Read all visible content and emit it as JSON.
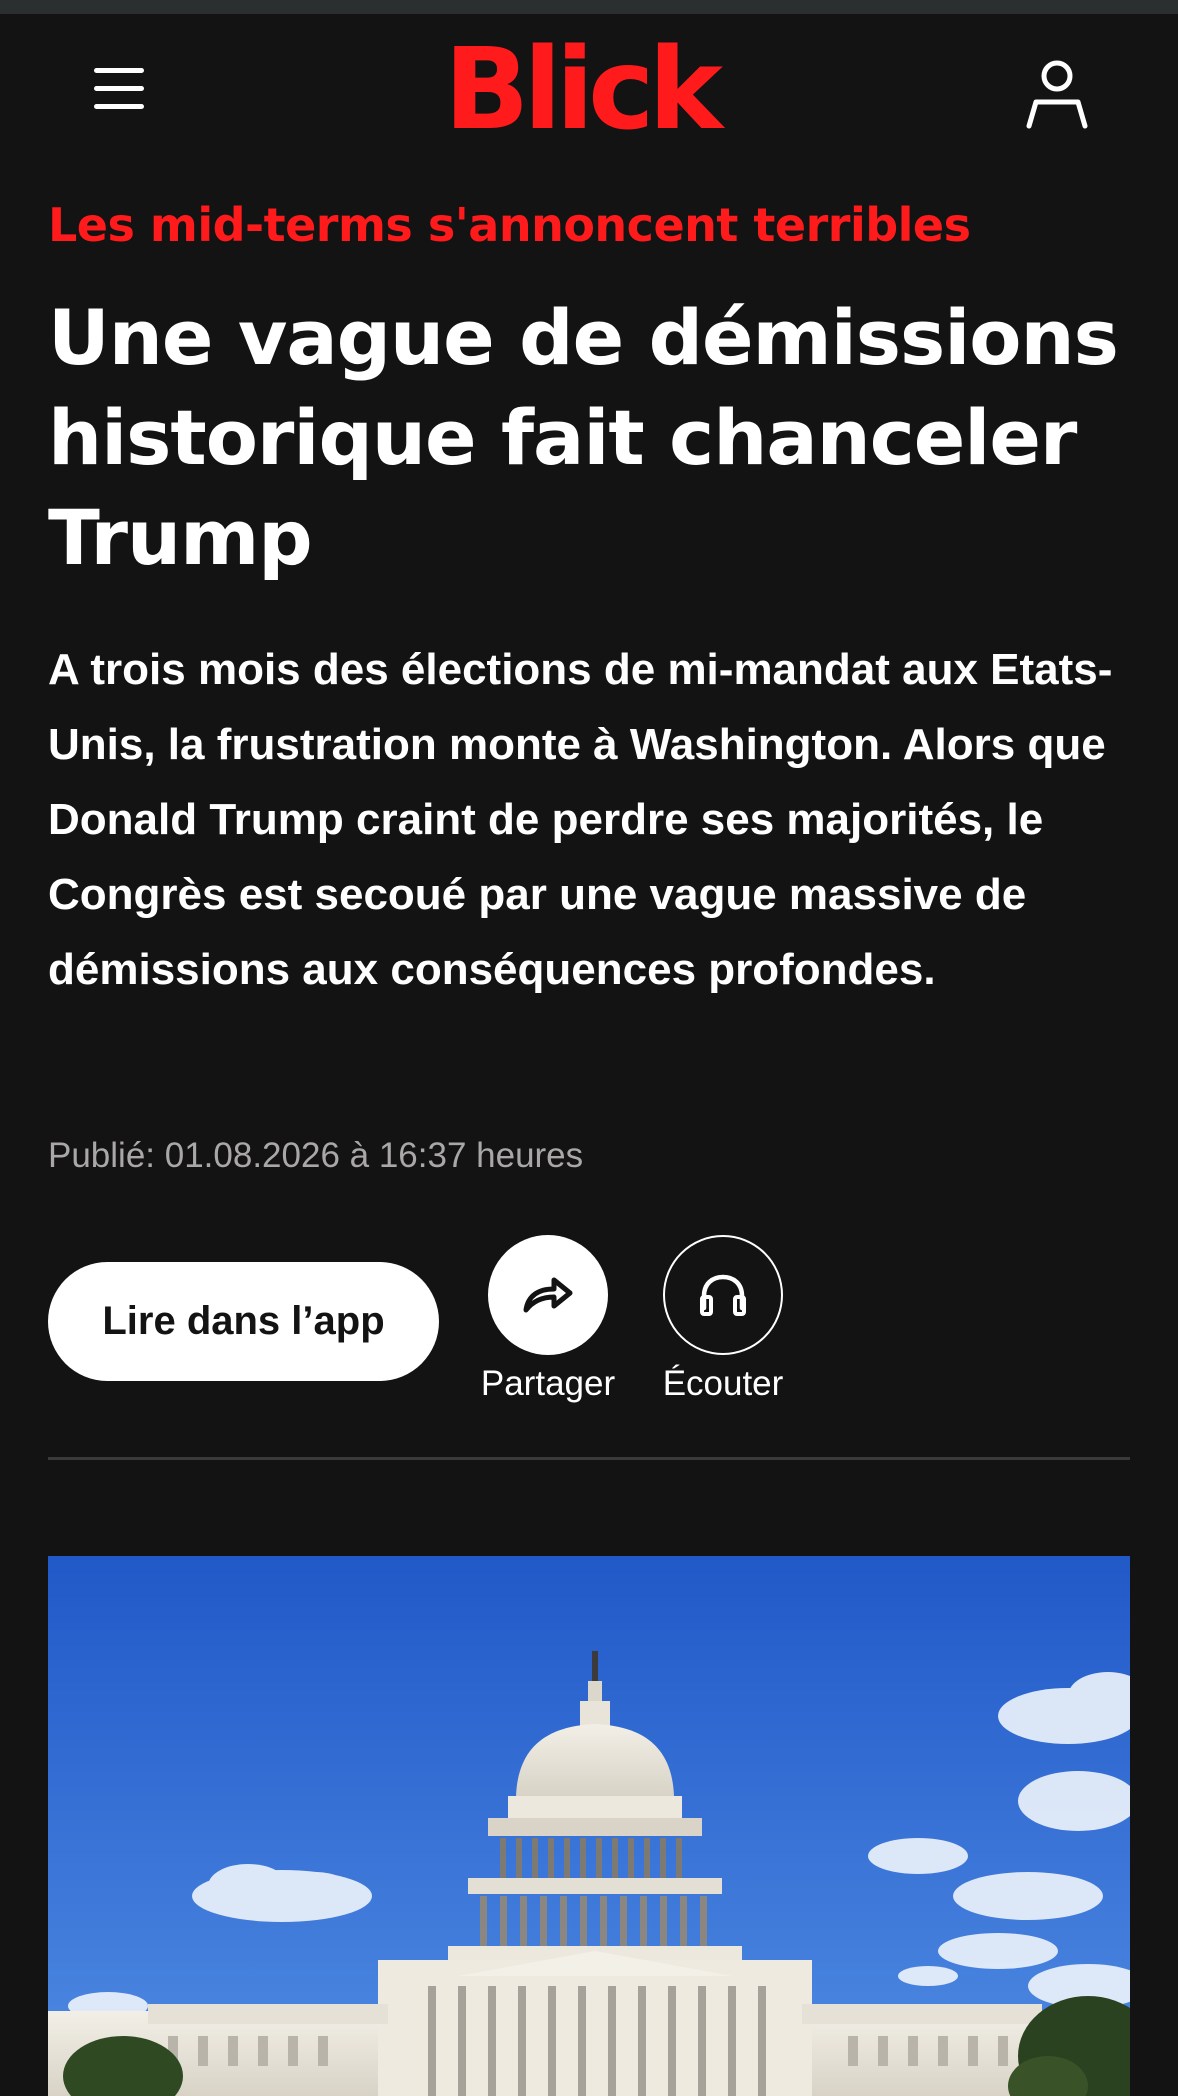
{
  "header": {
    "logo": "Blick",
    "menu_icon": "hamburger-menu-icon",
    "account_icon": "user-icon",
    "logo_color": "#ff1b1b"
  },
  "article": {
    "kicker": "Les mid-terms s'annoncent terribles",
    "title": "Une vague de démissions historique fait chanceler Trump",
    "lead": "A trois mois des élections de mi-mandat aux Etats-Unis, la frustration monte à Washington. Alors que Donald Trump craint de perdre ses majorités, le Congrès est secoué par une vague massive de démissions aux conséquences profondes.",
    "published": "Publié: 01.08.2026 à 16:37 heures"
  },
  "actions": {
    "app_button_label": "Lire dans l’app",
    "share_label": "Partager",
    "share_icon": "share-arrow-icon",
    "listen_label": "Écouter",
    "listen_icon": "headphones-icon"
  },
  "hero_image": {
    "subject": "capitol-building-photo"
  },
  "colors": {
    "background": "#141314",
    "accent": "#ff1b1b",
    "sky": "#2a6bd4"
  }
}
